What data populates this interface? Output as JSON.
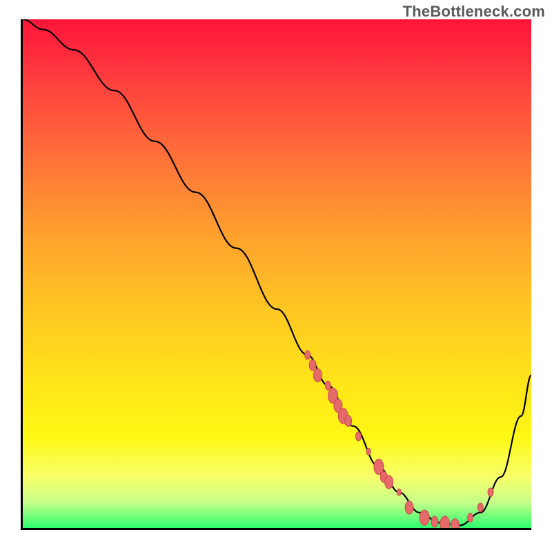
{
  "watermark": "TheBottleneck.com",
  "chart_data": {
    "type": "line",
    "title": "",
    "xlabel": "",
    "ylabel": "",
    "xlim": [
      0,
      100
    ],
    "ylim": [
      0,
      100
    ],
    "grid": false,
    "series": [
      {
        "name": "bottleneck-curve",
        "x": [
          0,
          4,
          10,
          18,
          26,
          34,
          42,
          50,
          56,
          60,
          65,
          70,
          74,
          78,
          82,
          86,
          90,
          94,
          98,
          100
        ],
        "y": [
          100,
          98,
          94,
          86,
          76,
          66,
          55,
          43,
          34,
          28,
          20,
          12,
          7,
          3,
          1,
          0.5,
          3,
          10,
          22,
          30
        ]
      }
    ],
    "markers": [
      {
        "x": 56,
        "y": 34,
        "r": 4
      },
      {
        "x": 57,
        "y": 32,
        "r": 5
      },
      {
        "x": 58,
        "y": 30,
        "r": 6
      },
      {
        "x": 60,
        "y": 28,
        "r": 4
      },
      {
        "x": 61,
        "y": 26,
        "r": 7
      },
      {
        "x": 62,
        "y": 24,
        "r": 6
      },
      {
        "x": 63,
        "y": 22,
        "r": 7
      },
      {
        "x": 64,
        "y": 21,
        "r": 5
      },
      {
        "x": 66,
        "y": 18,
        "r": 4
      },
      {
        "x": 68,
        "y": 15,
        "r": 3
      },
      {
        "x": 70,
        "y": 12,
        "r": 7
      },
      {
        "x": 71,
        "y": 10,
        "r": 5
      },
      {
        "x": 72,
        "y": 9,
        "r": 6
      },
      {
        "x": 74,
        "y": 7,
        "r": 3
      },
      {
        "x": 76,
        "y": 4,
        "r": 6
      },
      {
        "x": 79,
        "y": 2,
        "r": 7
      },
      {
        "x": 81,
        "y": 1.2,
        "r": 5
      },
      {
        "x": 83,
        "y": 0.8,
        "r": 7
      },
      {
        "x": 85,
        "y": 0.5,
        "r": 6
      },
      {
        "x": 88,
        "y": 2,
        "r": 4
      },
      {
        "x": 90,
        "y": 4,
        "r": 4
      },
      {
        "x": 92,
        "y": 7,
        "r": 4
      }
    ],
    "colors": {
      "curve": "#000000",
      "marker_fill": "#e76a6a",
      "marker_stroke": "#c74a4a",
      "gradient_top": "#ff143a",
      "gradient_bottom": "#2eff6e"
    }
  }
}
